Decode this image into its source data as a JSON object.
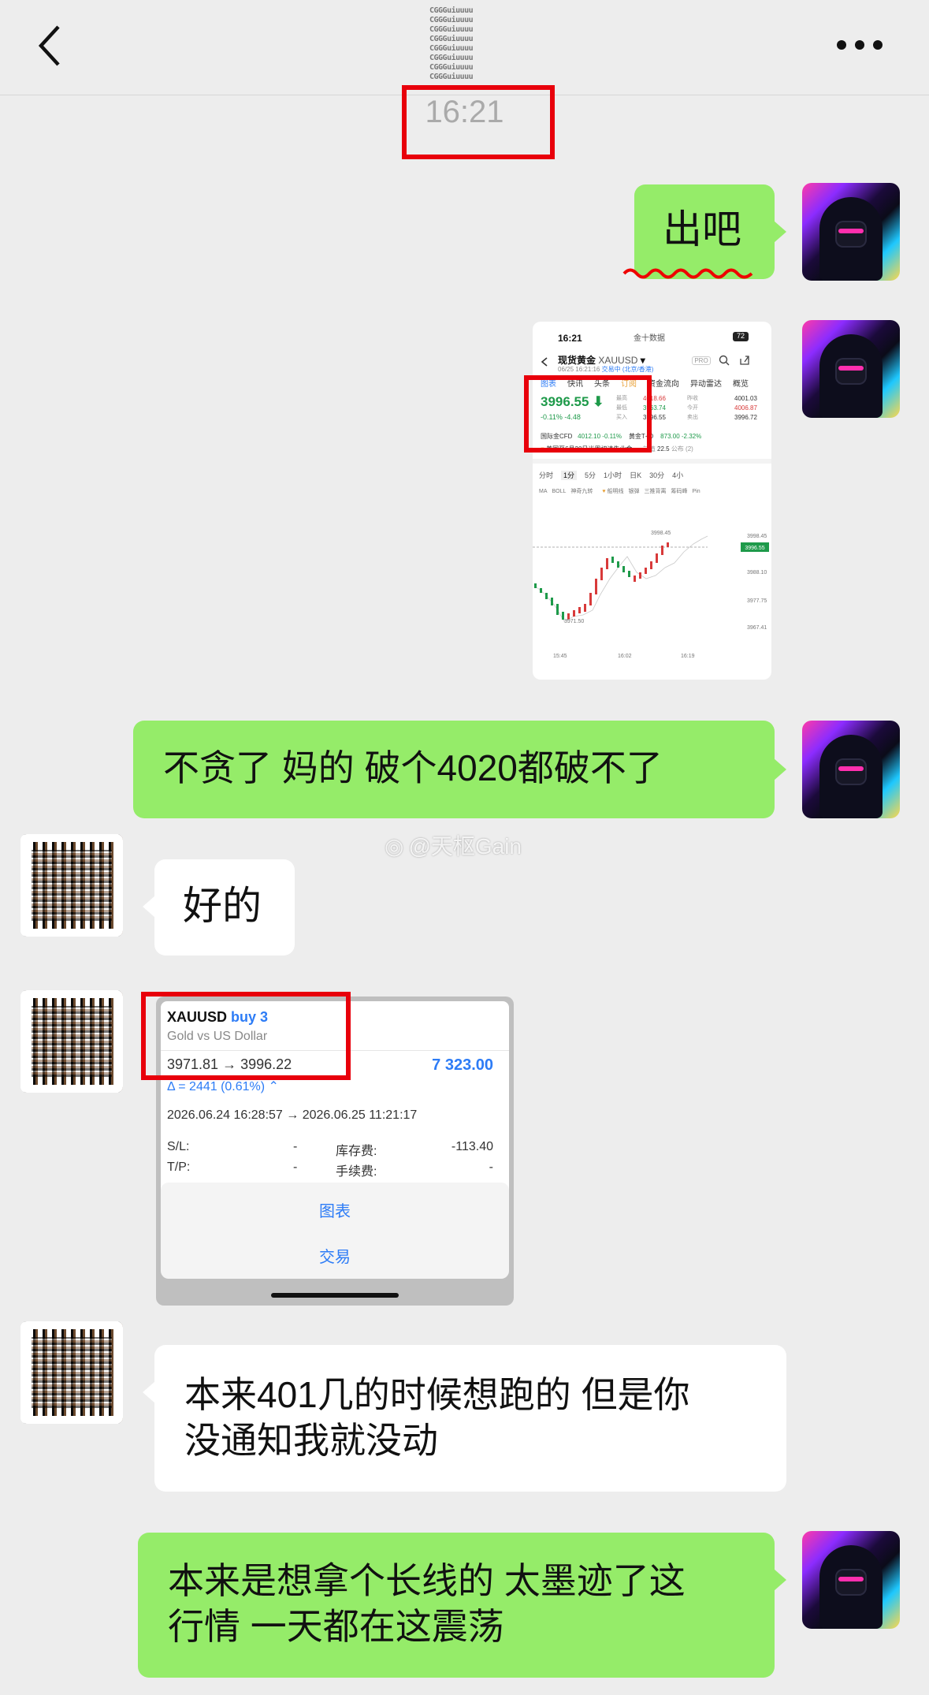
{
  "header": {
    "title_mosaic": "CGGGuiuuuu",
    "back_icon": "chevron-left-icon",
    "more_icon": "more-dots-icon"
  },
  "timestamp": "16:21",
  "messages": {
    "m1": "出吧",
    "m3": "不贪了 妈的 破个4020都破不了",
    "m4": "好的",
    "m6_line1": "本来401几的时候想跑的 但是你",
    "m6_line2": "没通知我就没动",
    "m7_line1": "本来是想拿个长线的 太墨迹了这",
    "m7_line2": "行情 一天都在这震荡"
  },
  "watermark": "@天枢Gain",
  "screenshot": {
    "status_time": "16:21",
    "status_app": "金十数据",
    "battery": "72",
    "title": "现货黄金",
    "symbol": "XAUUSD",
    "pro": "PRO",
    "date_line": "06/25 16:21:16",
    "date_tag1": "交易中",
    "date_tag2": "(北京/香港)",
    "tabs": [
      "图表",
      "快讯",
      "头条",
      "订阅",
      "资金流向",
      "异动雷达",
      "概览"
    ],
    "price": "3996.55",
    "change": "-0.11%",
    "change_abs": "-4.48",
    "labels_col1": [
      "最高",
      "最低",
      "买入"
    ],
    "values_col1": [
      "4018.66",
      "3963.74",
      "3996.55"
    ],
    "labels_col2": [
      "昨收",
      "今开",
      "卖出"
    ],
    "values_col2": [
      "4001.03",
      "4006.87",
      "3996.72"
    ],
    "cfd_label": "国际金CFD",
    "cfd_value": "4012.10",
    "cfd_change": "-0.11%",
    "td_label": "黄金T+D",
    "td_value": "873.00",
    "td_change": "-2.32%",
    "news": "美国至6月20日当周初请失业金...",
    "news_prev": "前值",
    "news_prev_val": "22.5",
    "news_pub": "公布",
    "news_count": "(2)",
    "periods": [
      "分时",
      "1分",
      "5分",
      "1小时",
      "日K",
      "30分",
      "4小"
    ],
    "indicators": [
      "MA",
      "BOLL",
      "神奇九转",
      "船明线",
      "银弹",
      "三推背离",
      "筹码峰",
      "Pin"
    ],
    "y_ticks": [
      "3998.45",
      "3996.55",
      "3988.10",
      "3977.75",
      "3967.41"
    ],
    "x_ticks": [
      "15:45",
      "16:02",
      "16:19"
    ],
    "low_mark": "3971.50",
    "high_mark": "3998.45"
  },
  "trade": {
    "symbol": "XAUUSD",
    "side": "buy 3",
    "desc": "Gold vs US Dollar",
    "prices": "3971.81 → 3996.22",
    "profit": "7 323.00",
    "delta": "Δ = 2441 (0.61%)",
    "times": "2026.06.24 16:28:57 → 2026.06.25 11:21:17",
    "sl_label": "S/L:",
    "sl_value": "-",
    "swap_label": "库存费:",
    "swap_value": "-113.40",
    "tp_label": "T/P:",
    "tp_value": "-",
    "fee_label": "手续费:",
    "fee_value": "-",
    "menu_chart": "图表",
    "menu_trade": "交易"
  },
  "colors": {
    "my_bubble": "#95ec69",
    "their_bubble": "#ffffff",
    "highlight": "#e8000b",
    "background": "#ededed"
  }
}
